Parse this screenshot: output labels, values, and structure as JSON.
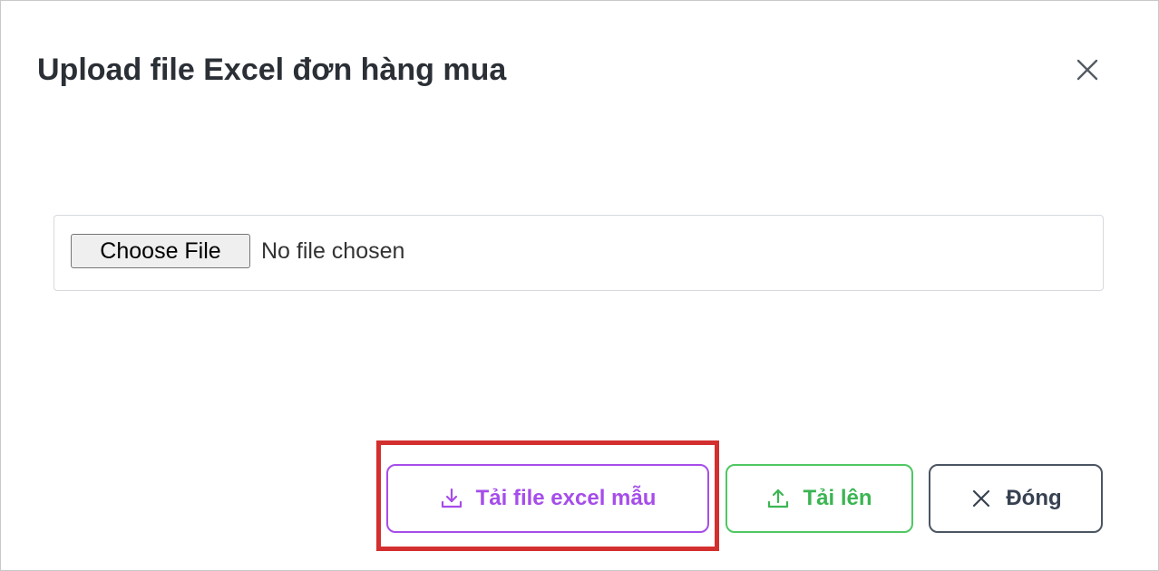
{
  "modal": {
    "title": "Upload file Excel đơn hàng mua",
    "close_icon": "close-icon"
  },
  "file_input": {
    "button_label": "Choose File",
    "status_text": "No file chosen"
  },
  "footer": {
    "download_template_label": "Tải file excel mẫu",
    "download_template_icon": "download-icon",
    "upload_label": "Tải lên",
    "upload_icon": "upload-icon",
    "close_label": "Đóng",
    "close_icon": "x-icon"
  },
  "colors": {
    "title": "#2b2f36",
    "template_button": "#a64dea",
    "upload_button": "#4fc763",
    "close_button": "#4b5563",
    "highlight": "#d32f2f"
  }
}
